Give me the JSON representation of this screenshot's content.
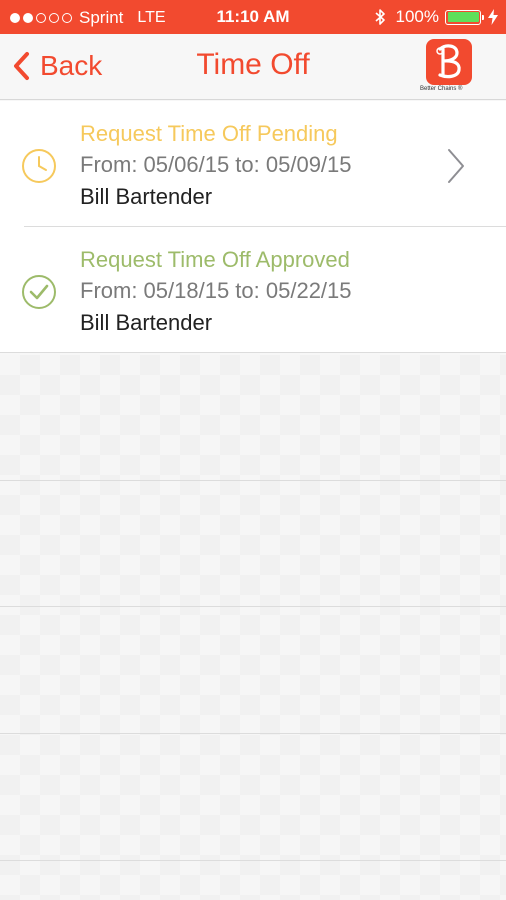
{
  "status_bar": {
    "carrier": "Sprint",
    "network": "LTE",
    "time": "11:10 AM",
    "battery_percent": "100%",
    "signal_bars": 2,
    "background_color": "#f24a2f",
    "battery_fill_color": "#5ee05a"
  },
  "nav": {
    "back_label": "Back",
    "title": "Time Off",
    "logo_caption": "Better Chains ®",
    "accent_color": "#f24a2f"
  },
  "requests": [
    {
      "status": "Request Time Off Pending",
      "range": "From: 05/06/15 to: 05/09/15",
      "name": "Bill Bartender",
      "icon": "clock-icon",
      "status_color": "#f6c95c",
      "has_disclosure": true
    },
    {
      "status": "Request Time Off Approved",
      "range": "From: 05/18/15 to: 05/22/15",
      "name": "Bill Bartender",
      "icon": "check-circle-icon",
      "status_color": "#9dbb6a",
      "has_disclosure": false
    }
  ]
}
